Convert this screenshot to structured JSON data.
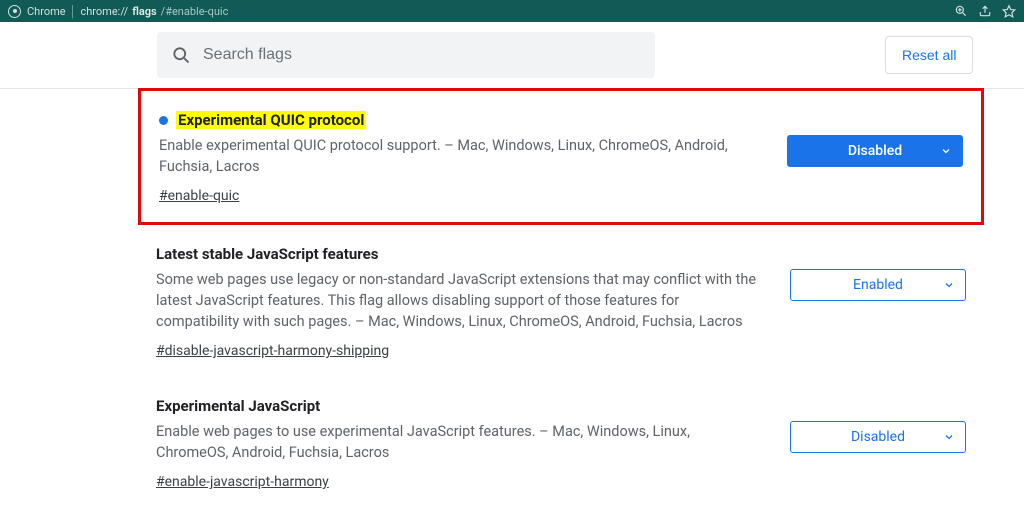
{
  "titlebar": {
    "app": "Chrome",
    "url_host": "chrome://",
    "url_bold": "flags",
    "url_rest": "/#enable-quic"
  },
  "search": {
    "placeholder": "Search flags"
  },
  "reset_label": "Reset all",
  "flags": [
    {
      "title": "Experimental QUIC protocol",
      "desc": "Enable experimental QUIC protocol support. – Mac, Windows, Linux, ChromeOS, Android, Fuchsia, Lacros",
      "anchor": "#enable-quic",
      "select_value": "Disabled",
      "highlighted": true,
      "dot": true,
      "primary_select": true
    },
    {
      "title": "Latest stable JavaScript features",
      "desc": "Some web pages use legacy or non-standard JavaScript extensions that may conflict with the latest JavaScript features. This flag allows disabling support of those features for compatibility with such pages. – Mac, Windows, Linux, ChromeOS, Android, Fuchsia, Lacros",
      "anchor": "#disable-javascript-harmony-shipping",
      "select_value": "Enabled",
      "highlighted": false,
      "dot": false,
      "primary_select": false
    },
    {
      "title": "Experimental JavaScript",
      "desc": "Enable web pages to use experimental JavaScript features. – Mac, Windows, Linux, ChromeOS, Android, Fuchsia, Lacros",
      "anchor": "#enable-javascript-harmony",
      "select_value": "Disabled",
      "highlighted": false,
      "dot": false,
      "primary_select": false
    }
  ]
}
